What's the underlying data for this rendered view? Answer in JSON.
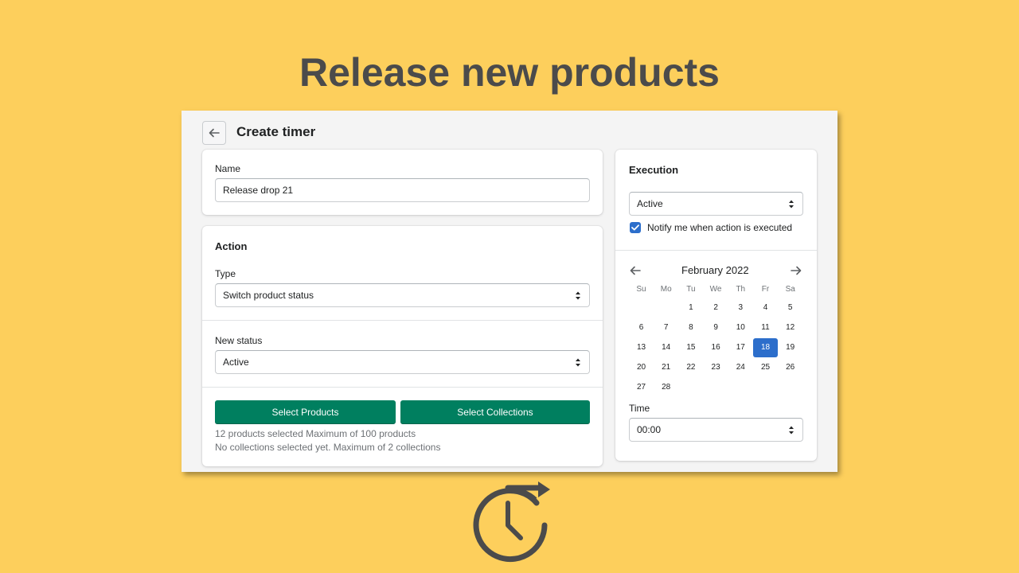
{
  "hero": {
    "title": "Release new products"
  },
  "header": {
    "title": "Create timer"
  },
  "name_card": {
    "label": "Name",
    "value": "Release drop 21"
  },
  "action_card": {
    "heading": "Action",
    "type_label": "Type",
    "type_value": "Switch product status",
    "status_label": "New status",
    "status_value": "Active",
    "select_products_label": "Select Products",
    "select_collections_label": "Select Collections",
    "products_help": "12 products selected Maximum of 100 products",
    "collections_help": "No collections selected yet. Maximum of 2 collections"
  },
  "execution_card": {
    "heading": "Execution",
    "status_value": "Active",
    "notify_label": "Notify me when action is executed",
    "notify_checked": true,
    "calendar": {
      "month_label": "February 2022",
      "weekdays": [
        "Su",
        "Mo",
        "Tu",
        "We",
        "Th",
        "Fr",
        "Sa"
      ],
      "first_weekday_index": 2,
      "days_in_month": 28,
      "selected_day": 18
    },
    "time_label": "Time",
    "time_value": "00:00"
  },
  "colors": {
    "background": "#fdcf5c",
    "primary_button": "#007f5f",
    "selected_day": "#2c6ecb",
    "hero_text": "#4b4b4b"
  },
  "icons": {
    "back": "arrow-left-icon",
    "prev_month": "arrow-left-icon",
    "next_month": "arrow-right-icon",
    "select": "chevron-up-down-icon",
    "checkbox": "checkmark-icon",
    "bottom": "clock-refresh-icon"
  }
}
